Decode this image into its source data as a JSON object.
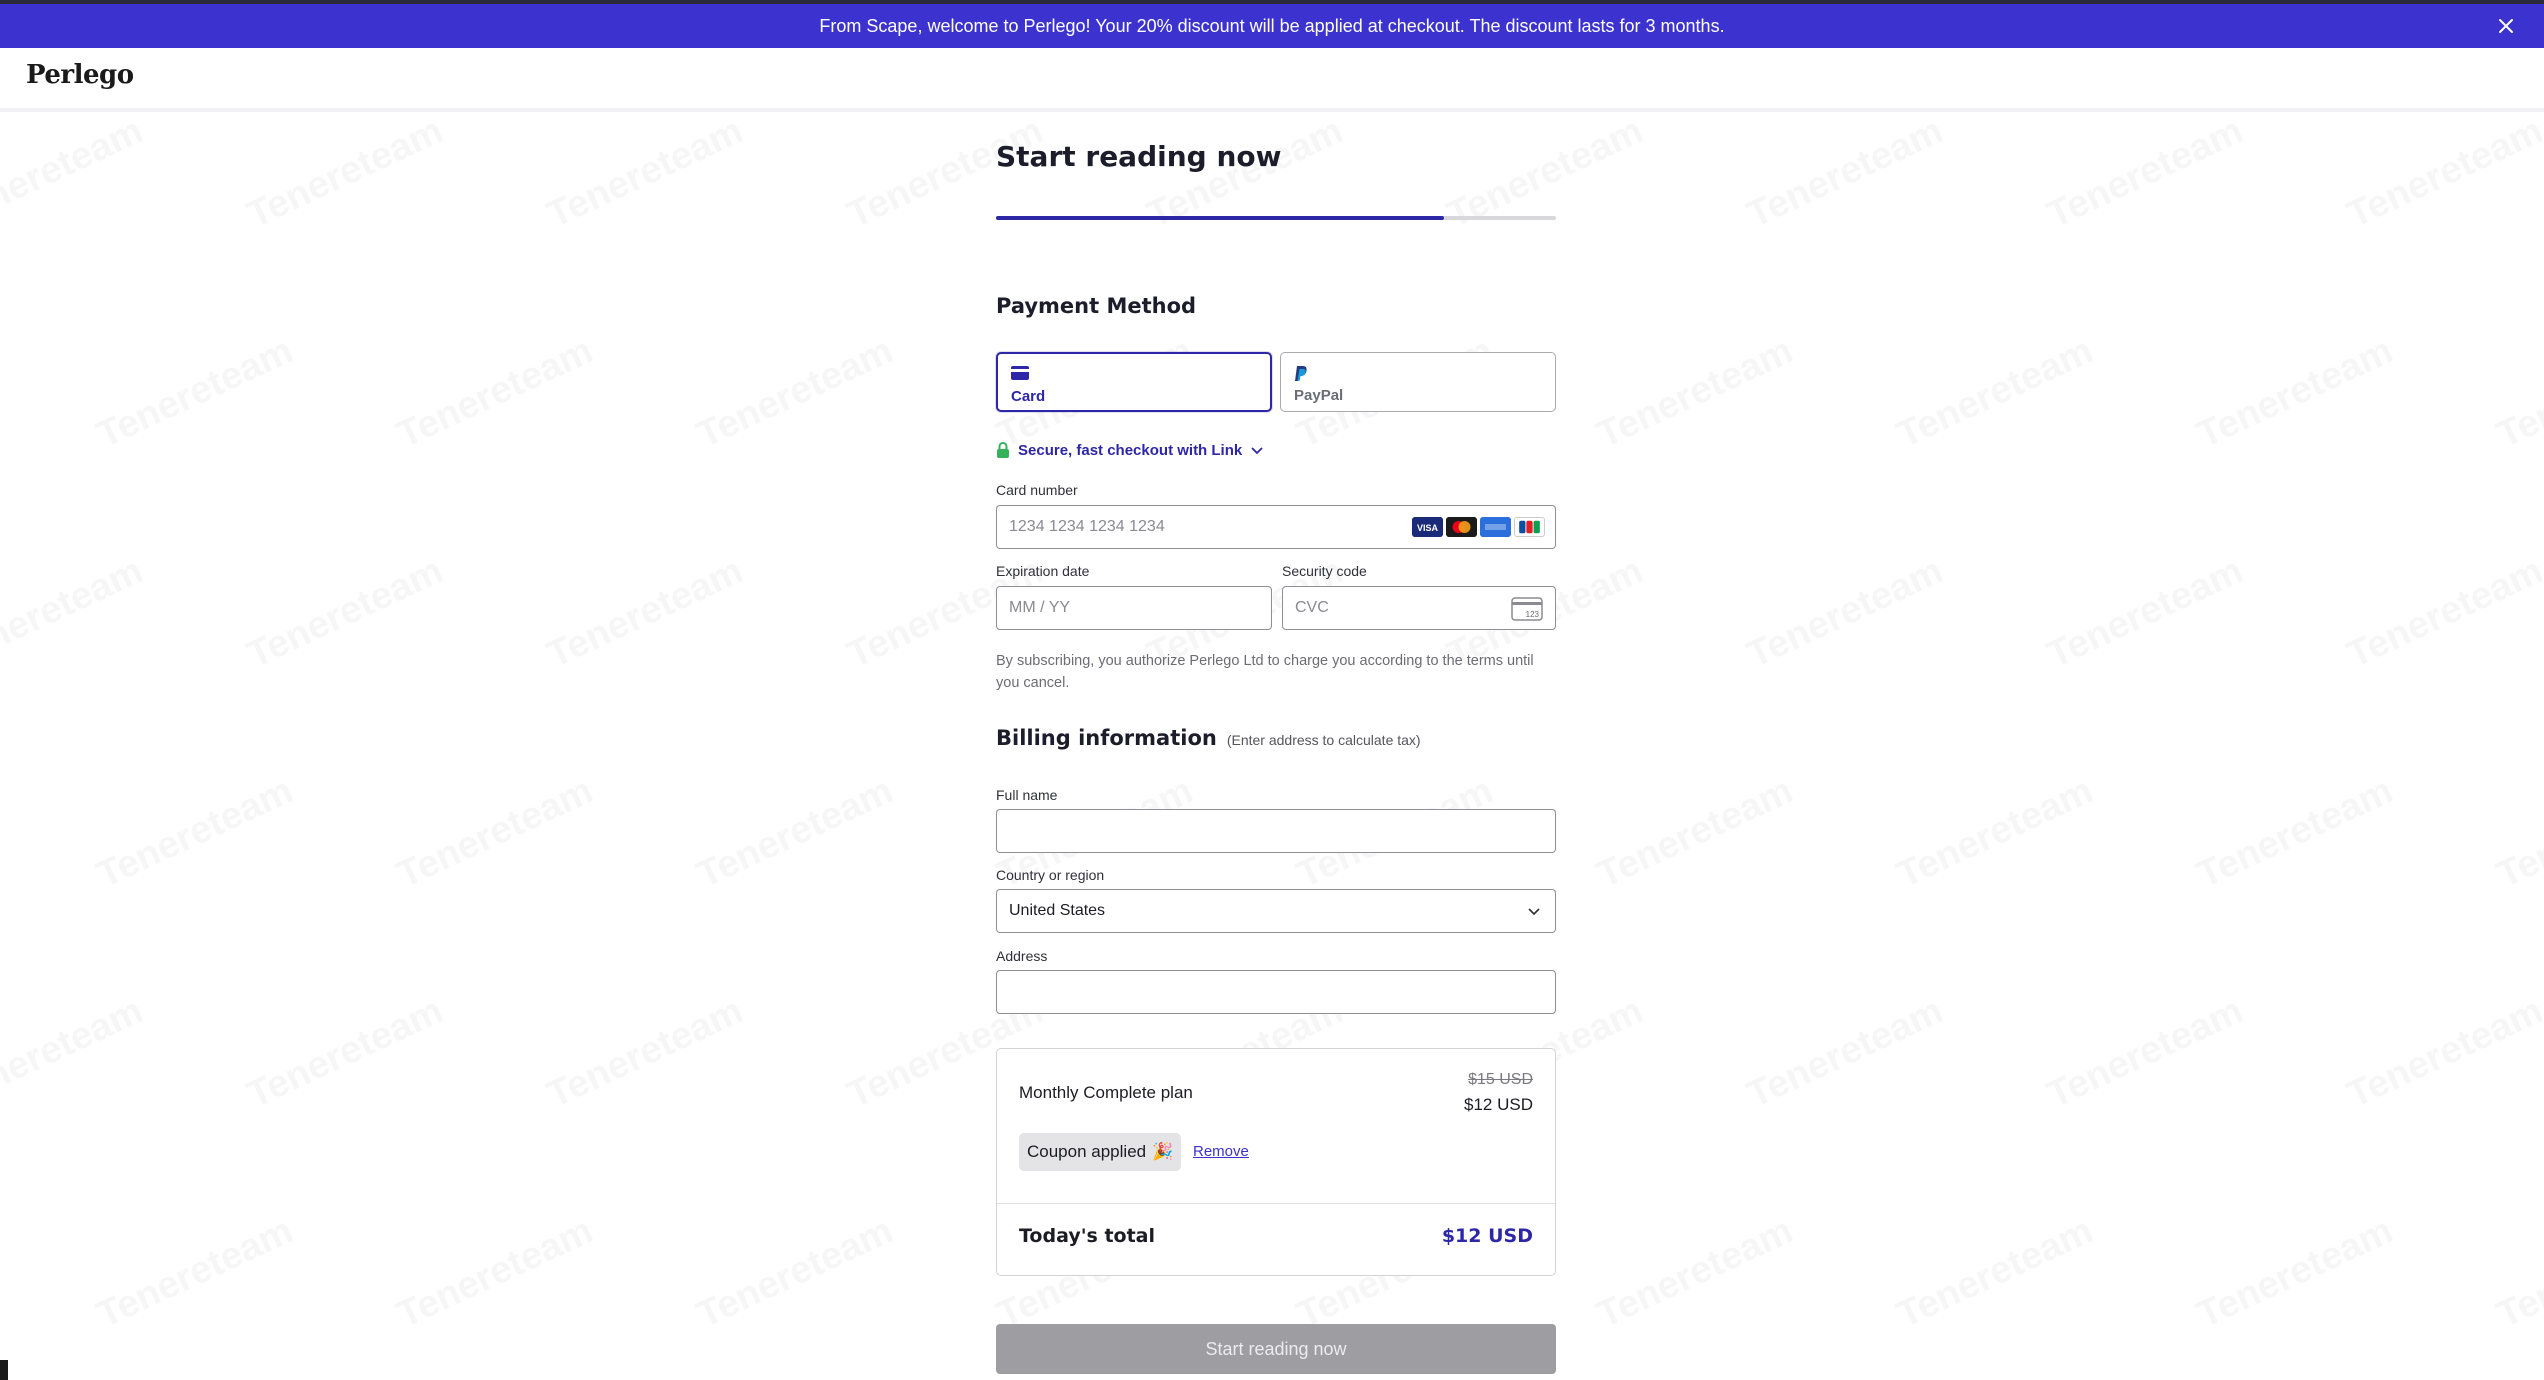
{
  "banner": {
    "message": "From Scape, welcome to Perlego! Your 20% discount will be applied at checkout. The discount lasts for 3 months.",
    "close_icon": "close-icon",
    "color": "#3b32cf"
  },
  "header": {
    "logo": "Perlego"
  },
  "watermark": {
    "text": "Tenereteam"
  },
  "checkout": {
    "title": "Start reading now",
    "progress": 0.8
  },
  "payment_method": {
    "title": "Payment Method",
    "tabs": [
      {
        "label": "Card",
        "icon": "credit-card-icon",
        "active": true
      },
      {
        "label": "PayPal",
        "icon": "paypal-icon",
        "active": false
      }
    ],
    "link_label": "Secure, fast checkout with Link",
    "card_number": {
      "label": "Card number",
      "placeholder": "1234 1234 1234 1234"
    },
    "card_brands": [
      "VISA",
      "mastercard",
      "AMEX",
      "JCB"
    ],
    "expiration": {
      "label": "Expiration date",
      "placeholder": "MM / YY"
    },
    "security_code": {
      "label": "Security code",
      "placeholder": "CVC",
      "hint": "123"
    },
    "terms": "By subscribing, you authorize Perlego Ltd to charge you according to the terms until you cancel."
  },
  "billing": {
    "title": "Billing information",
    "hint": "(Enter address to calculate tax)",
    "full_name": {
      "label": "Full name",
      "value": ""
    },
    "country": {
      "label": "Country or region",
      "value": "United States"
    },
    "address": {
      "label": "Address",
      "value": ""
    }
  },
  "summary": {
    "plan_name": "Monthly Complete plan",
    "price_old": "$15 USD",
    "price_new": "$12 USD",
    "coupon_label": "Coupon applied",
    "coupon_emoji": "🎉",
    "remove_label": "Remove",
    "total_label": "Today's total",
    "total_value": "$12 USD"
  },
  "cta": {
    "label": "Start reading now"
  },
  "colors": {
    "accent": "#2d27a8",
    "cta_disabled": "#9d9da2"
  }
}
